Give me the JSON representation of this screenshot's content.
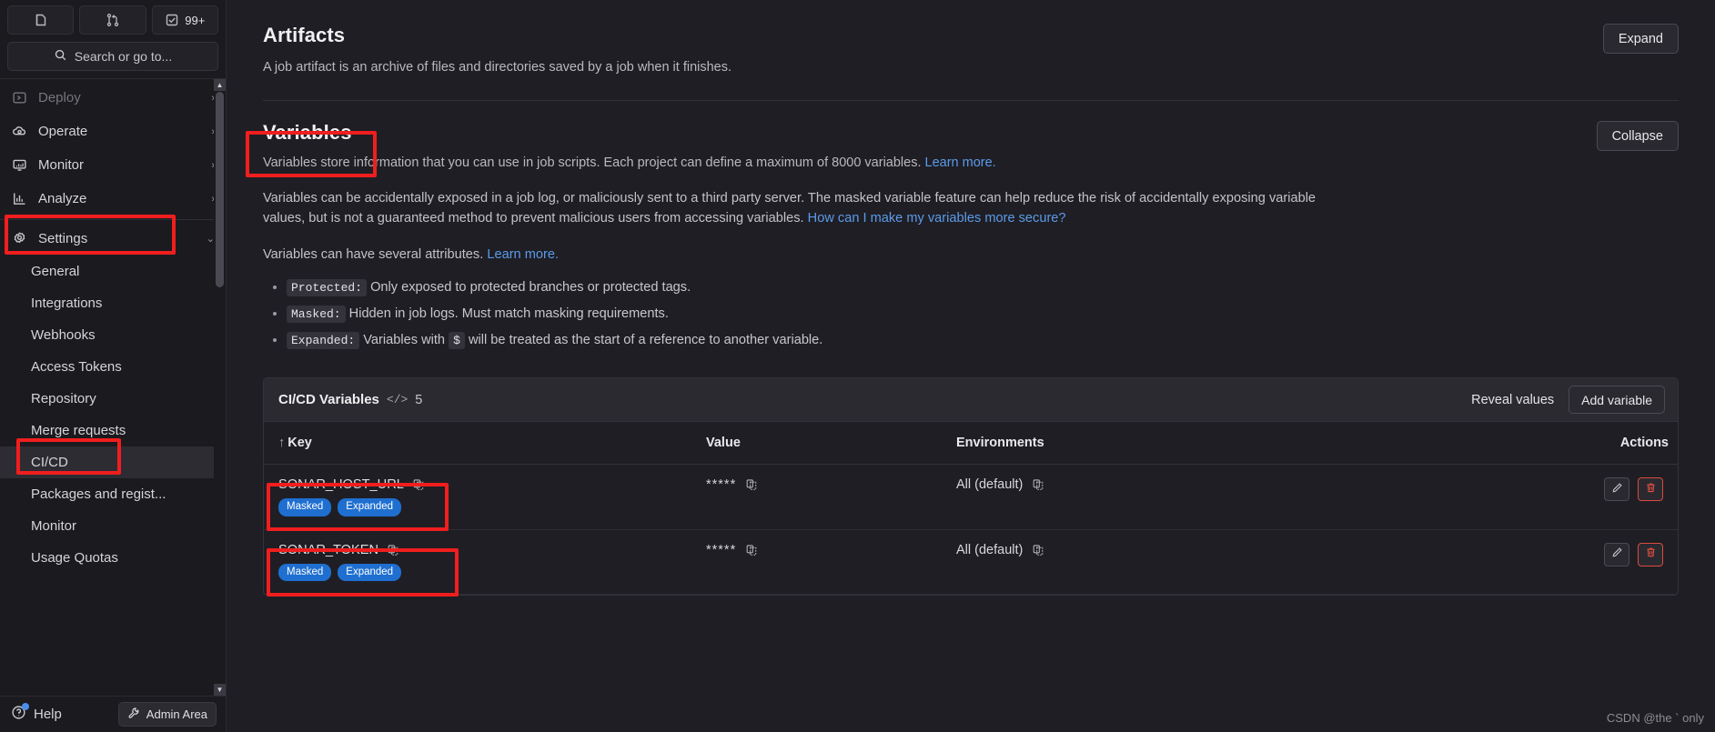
{
  "sidebar": {
    "top_buttons": [
      {
        "name": "page-icon",
        "icon": "page-icon",
        "label": ""
      },
      {
        "name": "merge-requests-icon",
        "icon": "merge-request-icon",
        "label": ""
      },
      {
        "name": "todos-icon",
        "icon": "todo-check-icon",
        "label": "99+"
      }
    ],
    "search_placeholder": "Search or go to...",
    "nav": [
      {
        "label": "Deploy",
        "icon": "deploy-icon",
        "chevron": "›",
        "dim": true
      },
      {
        "label": "Operate",
        "icon": "operate-icon",
        "chevron": "›",
        "dim": false
      },
      {
        "label": "Monitor",
        "icon": "monitor-icon",
        "chevron": "›",
        "dim": false
      },
      {
        "label": "Analyze",
        "icon": "analyze-icon",
        "chevron": "›",
        "dim": false
      },
      {
        "label": "Settings",
        "icon": "settings-gear-icon",
        "chevron": "⌄",
        "dim": false
      }
    ],
    "subnav": [
      {
        "label": "General",
        "active": false
      },
      {
        "label": "Integrations",
        "active": false
      },
      {
        "label": "Webhooks",
        "active": false
      },
      {
        "label": "Access Tokens",
        "active": false
      },
      {
        "label": "Repository",
        "active": false
      },
      {
        "label": "Merge requests",
        "active": false
      },
      {
        "label": "CI/CD",
        "active": true
      },
      {
        "label": "Packages and regist...",
        "active": false
      },
      {
        "label": "Monitor",
        "active": false
      },
      {
        "label": "Usage Quotas",
        "active": false
      }
    ],
    "help_label": "Help",
    "admin_label": "Admin Area"
  },
  "artifacts": {
    "title": "Artifacts",
    "description": "A job artifact is an archive of files and directories saved by a job when it finishes.",
    "expand_label": "Expand"
  },
  "variables": {
    "title": "Variables",
    "collapse_label": "Collapse",
    "intro_text": "Variables store information that you can use in job scripts. Each project can define a maximum of 8000 variables. ",
    "intro_link": "Learn more.",
    "security_text_1": "Variables can be accidentally exposed in a job log, or maliciously sent to a third party server. The masked variable feature can help reduce the risk of accidentally exposing variable values, but is not a guaranteed method to prevent malicious users from accessing variables. ",
    "security_link": "How can I make my variables more secure?",
    "attributes_text": "Variables can have several attributes. ",
    "attributes_link": "Learn more.",
    "attributes": [
      {
        "code": "Protected:",
        "text": " Only exposed to protected branches or protected tags.",
        "code2": "",
        "text2": ""
      },
      {
        "code": "Masked:",
        "text": " Hidden in job logs. Must match masking requirements.",
        "code2": "",
        "text2": ""
      },
      {
        "code": "Expanded:",
        "text": " Variables with ",
        "code2": "$",
        "text2": " will be treated as the start of a reference to another variable."
      }
    ]
  },
  "panel": {
    "title": "CI/CD Variables",
    "code_icon": "</>",
    "count": "5",
    "reveal_label": "Reveal values",
    "add_label": "Add variable",
    "columns": [
      {
        "label": "Key",
        "sort": "↑"
      },
      {
        "label": "Value",
        "sort": ""
      },
      {
        "label": "Environments",
        "sort": ""
      },
      {
        "label": "Actions",
        "sort": ""
      }
    ],
    "rows": [
      {
        "key": "SONAR_HOST_URL",
        "badges": [
          "Masked",
          "Expanded"
        ],
        "value": "*****",
        "environment": "All (default)",
        "actions": [
          "edit-icon",
          "delete-icon"
        ]
      },
      {
        "key": "SONAR_TOKEN",
        "badges": [
          "Masked",
          "Expanded"
        ],
        "value": "*****",
        "environment": "All (default)",
        "actions": [
          "edit-icon",
          "delete-icon"
        ]
      }
    ]
  },
  "watermark": "CSDN @the ` only"
}
